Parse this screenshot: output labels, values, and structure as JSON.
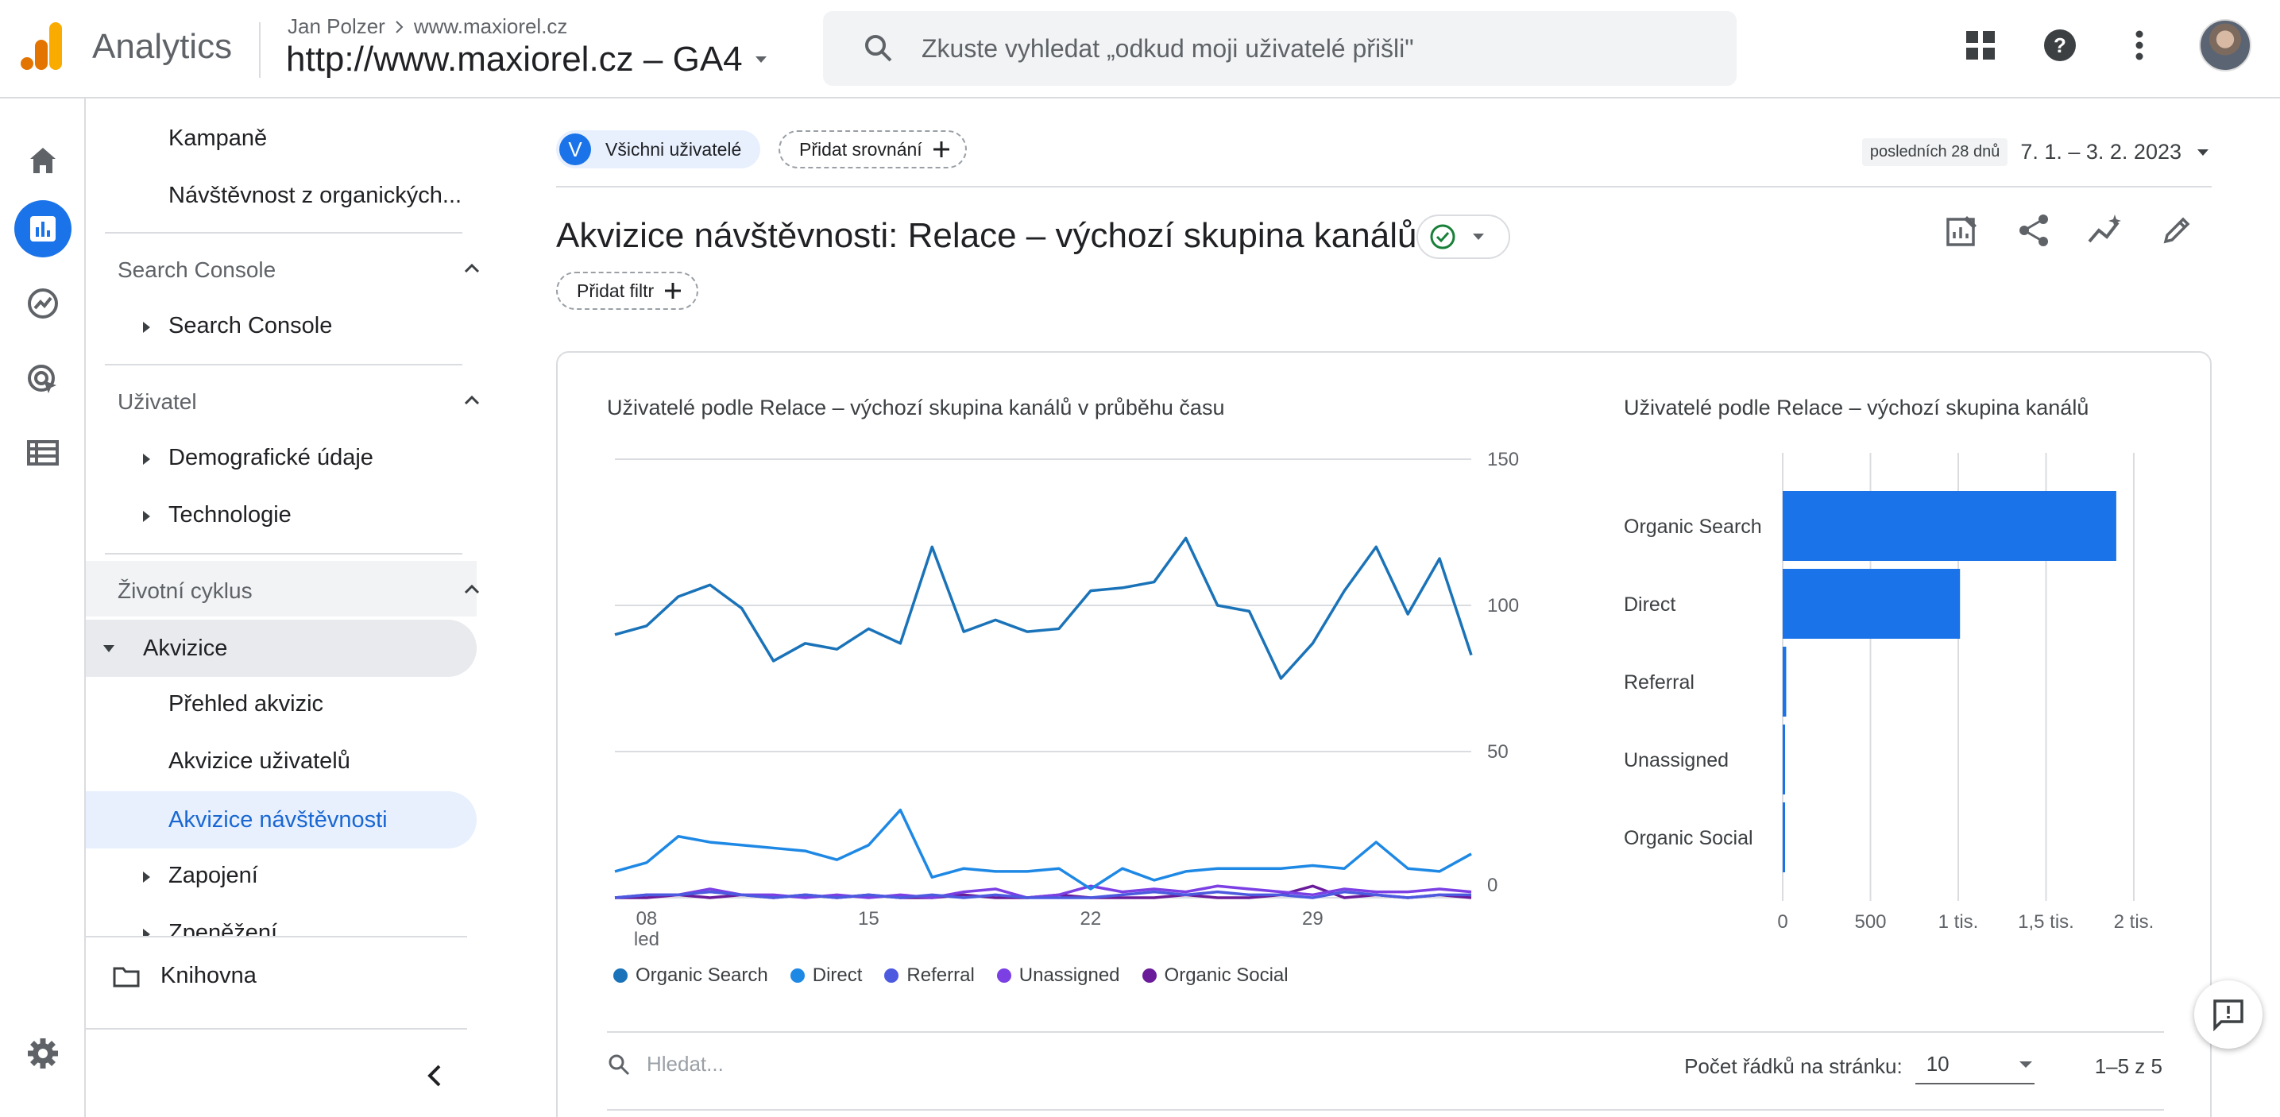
{
  "header": {
    "app_name": "Analytics",
    "account": "Jan Polzer",
    "property_site": "www.maxiorel.cz",
    "property": "http://www.maxiorel.cz – GA4",
    "search_placeholder": "Zkuste vyhledat „odkud moji uživatelé přišli\""
  },
  "nav": {
    "items_top": [
      "Kampaně",
      "Návštěvnost z organických..."
    ],
    "search_console_section": "Search Console",
    "search_console_item": "Search Console",
    "user_section": "Uživatel",
    "user_items": [
      "Demografické údaje",
      "Technologie"
    ],
    "lifecycle_section": "Životní cyklus",
    "acquisition": "Akvizice",
    "acquisition_items": [
      "Přehled akvizic",
      "Akvizice uživatelů",
      "Akvizice návštěvnosti"
    ],
    "engagement": "Zapojení",
    "monetization": "Zpeněžení",
    "library": "Knihovna"
  },
  "toolbar": {
    "segment_letter": "V",
    "segment": "Všichni uživatelé",
    "add_comparison": "Přidat srovnání",
    "date_label": "posledních 28 dnů",
    "date_range": "7. 1. – 3. 2. 2023",
    "add_filter": "Přidat filtr"
  },
  "page_title": "Akvizice návštěvnosti: Relace – výchozí skupina kanálů",
  "colors": {
    "accent": "#1a73e8",
    "organic_search": "#1a73b8",
    "direct": "#1e88e5",
    "referral": "#4c5ae0",
    "unassigned": "#7b3fe4",
    "organic_social": "#6a1b9a"
  },
  "chart_data": [
    {
      "type": "line",
      "title": "Uživatelé podle Relace – výchozí skupina kanálů v průběhu času",
      "x_ticks": [
        "08",
        "15",
        "22",
        "29"
      ],
      "x_tick_sub": "led",
      "x": [
        "7.1.",
        "8.1.",
        "9.1.",
        "10.1.",
        "11.1.",
        "12.1.",
        "13.1.",
        "14.1.",
        "15.1.",
        "16.1.",
        "17.1.",
        "18.1.",
        "19.1.",
        "20.1.",
        "21.1.",
        "22.1.",
        "23.1.",
        "24.1.",
        "25.1.",
        "26.1.",
        "27.1.",
        "28.1.",
        "29.1.",
        "30.1.",
        "31.1.",
        "1.2.",
        "2.2.",
        "3.2."
      ],
      "y_ticks": [
        "0",
        "50",
        "100",
        "150"
      ],
      "ylim": [
        0,
        150
      ],
      "y_axis_side": "right",
      "series": [
        {
          "name": "Organic Search",
          "values": [
            90,
            93,
            103,
            107,
            99,
            81,
            87,
            85,
            92,
            87,
            120,
            91,
            95,
            91,
            92,
            105,
            106,
            108,
            123,
            100,
            98,
            75,
            87,
            105,
            120,
            97,
            116,
            83
          ]
        },
        {
          "name": "Direct",
          "values": [
            9,
            12,
            21,
            19,
            18,
            17,
            16,
            13,
            18,
            30,
            7,
            10,
            9,
            9,
            10,
            3,
            10,
            6,
            9,
            10,
            10,
            10,
            11,
            10,
            19,
            10,
            9,
            15
          ]
        },
        {
          "name": "Referral",
          "values": [
            0,
            1,
            1,
            2,
            1,
            0,
            1,
            0,
            1,
            0,
            1,
            0,
            1,
            0,
            0,
            0,
            1,
            2,
            1,
            2,
            1,
            1,
            0,
            2,
            1,
            0,
            1,
            1
          ]
        },
        {
          "name": "Unassigned",
          "values": [
            0,
            1,
            1,
            3,
            1,
            1,
            0,
            1,
            0,
            1,
            0,
            2,
            3,
            0,
            1,
            4,
            2,
            3,
            2,
            4,
            3,
            2,
            1,
            3,
            2,
            2,
            3,
            2
          ]
        },
        {
          "name": "Organic Social",
          "values": [
            0,
            0,
            1,
            0,
            1,
            0,
            1,
            0,
            1,
            0,
            0,
            1,
            0,
            0,
            1,
            0,
            0,
            0,
            1,
            0,
            0,
            1,
            4,
            0,
            1,
            0,
            1,
            0
          ]
        }
      ]
    },
    {
      "type": "bar",
      "orientation": "horizontal",
      "title": "Uživatelé podle Relace – výchozí skupina kanálů",
      "categories": [
        "Organic Search",
        "Direct",
        "Referral",
        "Unassigned",
        "Organic Social"
      ],
      "values": [
        1900,
        1010,
        20,
        12,
        8
      ],
      "x_ticks": [
        "0",
        "500",
        "1 tis.",
        "1,5 tis.",
        "2 tis."
      ],
      "xlim": [
        0,
        2000
      ],
      "grid": true
    }
  ],
  "table": {
    "search_placeholder": "Hledat...",
    "rows_label": "Počet řádků na stránku:",
    "rows_value": "10",
    "pagination": "1–5 z 5"
  }
}
